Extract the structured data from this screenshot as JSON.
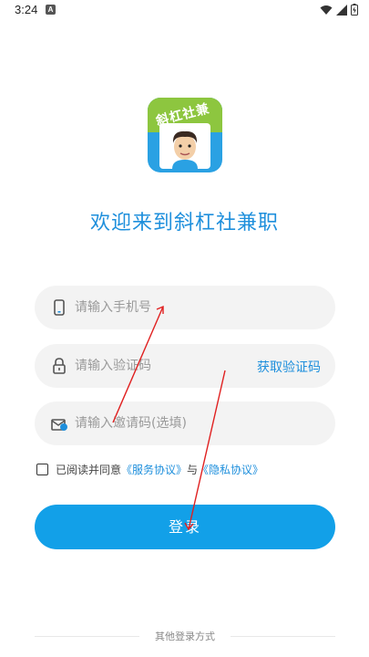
{
  "status_bar": {
    "time": "3:24",
    "notification_letter": "A"
  },
  "logo": {
    "text": "斜杠社兼职"
  },
  "welcome": "欢迎来到斜杠社兼职",
  "form": {
    "phone_placeholder": "请输入手机号",
    "code_placeholder": "请输入验证码",
    "get_code_label": "获取验证码",
    "invite_placeholder": "请输入邀请码(选填)"
  },
  "agreement": {
    "prefix": "已阅读并同意",
    "service_link": "《服务协议》",
    "conjunction": "与",
    "privacy_link": "《隐私协议》"
  },
  "login_label": "登录",
  "other_login": "其他登录方式",
  "colors": {
    "accent": "#1e8fdc",
    "button": "#12a0e8",
    "annotation": "#e02020"
  }
}
